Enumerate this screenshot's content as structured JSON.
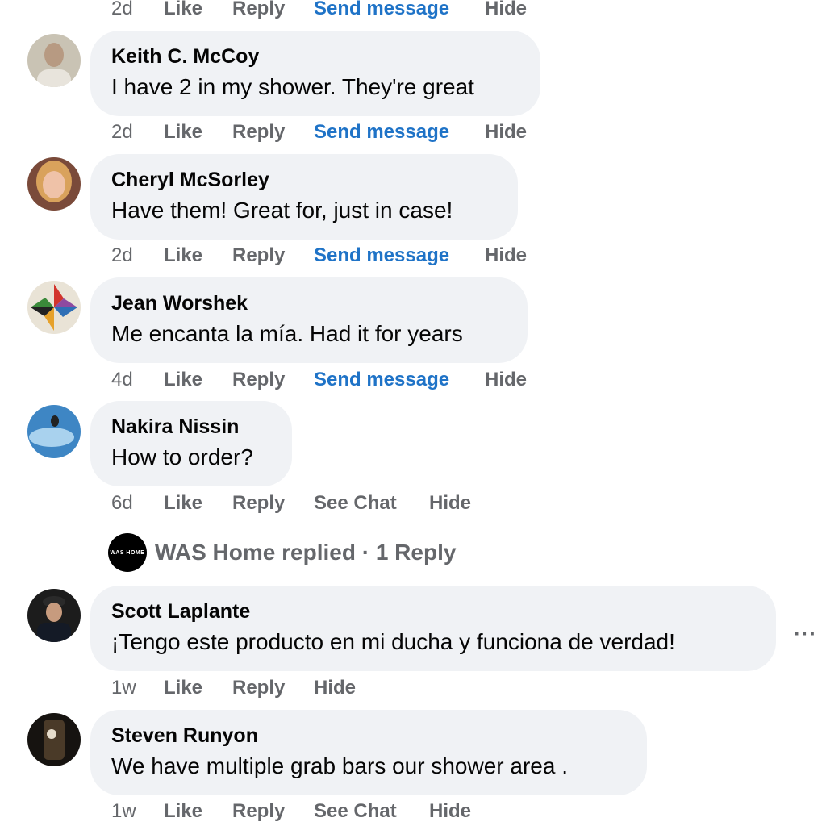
{
  "top_actions": {
    "time": "2d",
    "like": "Like",
    "reply": "Reply",
    "send_message": "Send message",
    "hide": "Hide"
  },
  "comments": [
    {
      "name": "Keith C. McCoy",
      "text": "I have 2 in my shower. They're great",
      "time": "2d",
      "like": "Like",
      "reply": "Reply",
      "send_message": "Send message",
      "hide": "Hide"
    },
    {
      "name": "Cheryl McSorley",
      "text": "Have them! Great for, just in case!",
      "time": "2d",
      "like": "Like",
      "reply": "Reply",
      "send_message": "Send message",
      "hide": "Hide"
    },
    {
      "name": "Jean Worshek",
      "text": "Me encanta la mía. Had it for years",
      "time": "4d",
      "like": "Like",
      "reply": "Reply",
      "send_message": "Send message",
      "hide": "Hide"
    },
    {
      "name": "Nakira Nissin",
      "text": "How to order?",
      "time": "6d",
      "like": "Like",
      "reply": "Reply",
      "see_chat": "See Chat",
      "hide": "Hide"
    },
    {
      "name": "Scott Laplante",
      "text": "¡Tengo este producto en mi ducha y funciona de verdad!",
      "time": "1w",
      "like": "Like",
      "reply": "Reply",
      "hide": "Hide"
    },
    {
      "name": "Steven Runyon",
      "text": "We have multiple grab bars our shower area .",
      "time": "1w",
      "like": "Like",
      "reply": "Reply",
      "see_chat": "See Chat",
      "hide": "Hide"
    }
  ],
  "reply_thread": {
    "logo_text": "WAS HOME",
    "text": "WAS Home replied · 1 Reply"
  },
  "more_icon": "···",
  "colors": {
    "bubble": "#f0f2f5",
    "link_blue": "#1f73c7",
    "meta_gray": "#65676b"
  }
}
